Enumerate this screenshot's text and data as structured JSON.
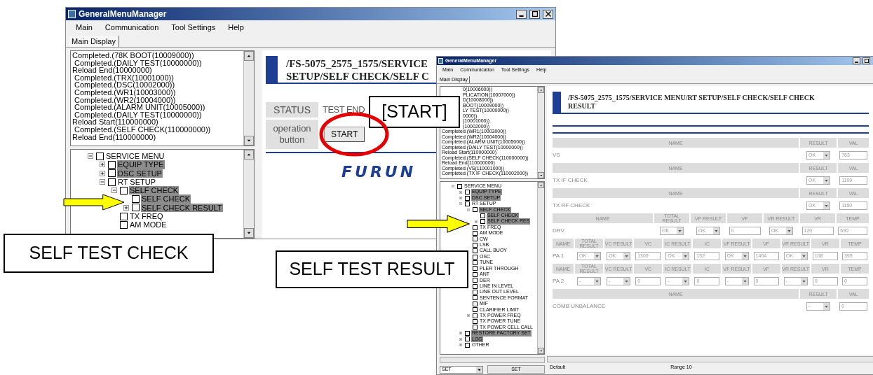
{
  "self_check_window": {
    "title": "GeneralMenuManager",
    "menu": [
      "Main",
      "Communication",
      "Tool Settings",
      "Help"
    ],
    "tab": "Main Display",
    "log": [
      "Completed.(78K BOOT(10009000))",
      " Completed.(DAILY TEST(10000000))",
      "Reload End(10000000)",
      " Completed.(TRX(10001000))",
      " Completed.(DSC(10002000))",
      " Completed.(WR1(10003000))",
      " Completed.(WR2(10004000))",
      " Completed.(ALARM UNIT(10005000))",
      " Completed.(DAILY TEST(10000000))",
      "Reload Start(110000000)",
      " Completed.(SELF CHECK(110000000))",
      "Reload End(110000000)"
    ],
    "tree": [
      {
        "label": "SERVICE MENU",
        "kind": "branch",
        "expanded": true,
        "checked": false,
        "highlighted": false,
        "children": [
          {
            "label": "EQUIP TYPE",
            "kind": "branch",
            "expanded": false,
            "checked": false,
            "highlighted": true
          },
          {
            "label": "DSC SETUP",
            "kind": "branch",
            "expanded": false,
            "checked": false,
            "highlighted": true
          },
          {
            "label": "RT SETUP",
            "kind": "branch",
            "expanded": true,
            "checked": false,
            "highlighted": false,
            "children": [
              {
                "label": "SELF CHECK",
                "kind": "branch",
                "expanded": true,
                "checked": false,
                "highlighted": true,
                "children": [
                  {
                    "label": "SELF CHECK",
                    "kind": "leaf",
                    "checked": false,
                    "highlighted": true
                  },
                  {
                    "label": "SELF CHECK RESULT",
                    "kind": "branch",
                    "expanded": false,
                    "checked": false,
                    "highlighted": true
                  }
                ]
              },
              {
                "label": "TX FREQ",
                "kind": "leaf",
                "checked": false,
                "highlighted": false
              },
              {
                "label": "AM MODE",
                "kind": "leaf",
                "checked": false,
                "highlighted": false
              }
            ]
          }
        ]
      }
    ],
    "panel": {
      "path_lines": [
        "/FS-5075_2575_1575/SERVICE",
        "SETUP/SELF CHECK/SELF C"
      ],
      "status_label": "STATUS",
      "status_value": "TEST END",
      "operation_label": "operation button",
      "button": "START",
      "logo": "FURUN"
    }
  },
  "self_check_result_window": {
    "title": "GeneralMenuManager",
    "menu": [
      "Main",
      "Communication",
      "Tool Settings",
      "Help"
    ],
    "tab": "Main Display",
    "log_partial": [
      "0(10006000))",
      "PLICATION(10007000))",
      "D(10008000))",
      "BOOT(10009000))",
      "LY TEST(10000000))",
      "0000))",
      "(10001000))",
      "(10002000))"
    ],
    "log": [
      "Completed.(WR1(10003000))",
      "Completed.(WR2(10004000))",
      "Completed.(ALARM UNIT(10005000))",
      "Completed.(DAILY TEST(10000000))",
      "Reload Start(110000000)",
      "Completed.(SELF CHECK(110000000))",
      "Reload End(110000000)",
      "Completed.(VS(110001000))",
      "Completed.(TX IF CHECK(110002000))"
    ],
    "tree": [
      {
        "label": "SERVICE MENU",
        "kind": "branch",
        "expanded": true,
        "checked": false,
        "highlighted": false,
        "children": [
          {
            "label": "EQUIP TYPE",
            "kind": "branch",
            "expanded": false,
            "checked": false,
            "highlighted": true
          },
          {
            "label": "DSC SETUP",
            "kind": "branch",
            "expanded": false,
            "checked": false,
            "highlighted": true
          },
          {
            "label": "RT SETUP",
            "kind": "branch",
            "expanded": true,
            "checked": false,
            "highlighted": false,
            "children": [
              {
                "label": "SELF CHECK",
                "kind": "branch",
                "expanded": true,
                "checked": false,
                "highlighted": true,
                "children": [
                  {
                    "label": "SELF CHECK",
                    "kind": "leaf",
                    "checked": false,
                    "highlighted": true
                  },
                  {
                    "label": "SELF CHECK RES",
                    "kind": "branch",
                    "expanded": false,
                    "checked": false,
                    "highlighted": true
                  }
                ]
              },
              {
                "label": "TX FREQ",
                "kind": "leaf",
                "checked": false,
                "highlighted": false
              },
              {
                "label": "AM MODE",
                "kind": "leaf",
                "checked": false,
                "highlighted": false
              },
              {
                "label": "CW",
                "kind": "leaf",
                "checked": false,
                "highlighted": false
              },
              {
                "label": "LSB",
                "kind": "leaf",
                "checked": false,
                "highlighted": false
              },
              {
                "label": "CALL BUOY",
                "kind": "leaf",
                "checked": false,
                "highlighted": false
              },
              {
                "label": "OSC",
                "kind": "leaf",
                "checked": false,
                "highlighted": false
              },
              {
                "label": "TUNE",
                "kind": "leaf",
                "checked": false,
                "highlighted": false
              },
              {
                "label": "PLER THROUGH",
                "kind": "leaf",
                "checked": false,
                "highlighted": false
              },
              {
                "label": "ANT",
                "kind": "leaf",
                "checked": false,
                "highlighted": false
              },
              {
                "label": "DER",
                "kind": "leaf",
                "checked": false,
                "highlighted": false
              },
              {
                "label": "LINE IN LEVEL",
                "kind": "leaf",
                "checked": false,
                "highlighted": false
              },
              {
                "label": "LINE OUT LEVEL",
                "kind": "leaf",
                "checked": false,
                "highlighted": false
              },
              {
                "label": "SENTENCE FORMAT",
                "kind": "leaf",
                "checked": false,
                "highlighted": false
              },
              {
                "label": "MIF",
                "kind": "leaf",
                "checked": false,
                "highlighted": false
              },
              {
                "label": "CLARIFIER LIMIT",
                "kind": "leaf",
                "checked": false,
                "highlighted": false
              },
              {
                "label": "TX POWER FREQ",
                "kind": "branch",
                "expanded": false,
                "checked": false,
                "highlighted": false
              },
              {
                "label": "TX POWER TUNE",
                "kind": "leaf",
                "checked": false,
                "highlighted": false
              },
              {
                "label": "TX POWER CELL CALL",
                "kind": "leaf",
                "checked": false,
                "highlighted": false
              }
            ]
          },
          {
            "label": "RESTORE FACTORY SET",
            "kind": "branch",
            "expanded": false,
            "checked": false,
            "highlighted": true
          },
          {
            "label": "LOG",
            "kind": "branch",
            "expanded": false,
            "checked": false,
            "highlighted": true
          },
          {
            "label": "OTHER",
            "kind": "branch",
            "expanded": false,
            "checked": false,
            "highlighted": false
          }
        ]
      }
    ],
    "set_select": "SET",
    "set_button": "SET",
    "panel": {
      "path": "/FS-5075_2575_1575/SERVICE MENU/RT SETUP/SELF CHECK/SELF CHECK RESULT",
      "sections": [
        {
          "columns": [
            "NAME",
            "RESULT",
            "VAL"
          ],
          "rows": [
            {
              "cells": [
                {
                  "kind": "text",
                  "value": "VS"
                },
                {
                  "kind": "select",
                  "value": "OK"
                },
                {
                  "kind": "input",
                  "value": "763"
                }
              ]
            }
          ]
        },
        {
          "columns": [
            "NAME",
            "RESULT",
            "VAL"
          ],
          "rows": [
            {
              "cells": [
                {
                  "kind": "text",
                  "value": "TX IF CHECK"
                },
                {
                  "kind": "select",
                  "value": "OK"
                },
                {
                  "kind": "input",
                  "value": "1109"
                }
              ]
            }
          ]
        },
        {
          "columns": [
            "NAME",
            "RESULT",
            "VAL"
          ],
          "rows": [
            {
              "cells": [
                {
                  "kind": "text",
                  "value": "TX RF CHECK"
                },
                {
                  "kind": "select",
                  "value": "OK"
                },
                {
                  "kind": "input",
                  "value": "1150"
                }
              ]
            }
          ]
        },
        {
          "columns": [
            "NAME",
            "TOTAL RESULT",
            "VF RESULT",
            "VF",
            "VR RESULT",
            "VR",
            "TEMP"
          ],
          "rows": [
            {
              "cells": [
                {
                  "kind": "text",
                  "value": "DRV"
                },
                {
                  "kind": "select",
                  "value": "OK"
                },
                {
                  "kind": "select",
                  "value": "OK"
                },
                {
                  "kind": "input",
                  "value": "0"
                },
                {
                  "kind": "select",
                  "value": "OK"
                },
                {
                  "kind": "input",
                  "value": "120"
                },
                {
                  "kind": "input",
                  "value": "690"
                }
              ]
            }
          ]
        },
        {
          "columns": [
            "NAME",
            "TOTAL RESULT",
            "VC RESULT",
            "VC",
            "IC RESULT",
            "IC",
            "VF RESULT",
            "VF",
            "VR RESULT",
            "VR",
            "TEMP"
          ],
          "rows": [
            {
              "cells": [
                {
                  "kind": "text",
                  "value": "PA 1"
                },
                {
                  "kind": "select",
                  "value": "OK"
                },
                {
                  "kind": "select",
                  "value": "OK"
                },
                {
                  "kind": "input",
                  "value": "1300"
                },
                {
                  "kind": "select",
                  "value": "OK"
                },
                {
                  "kind": "input",
                  "value": "152"
                },
                {
                  "kind": "select",
                  "value": "OK"
                },
                {
                  "kind": "input",
                  "value": "1404"
                },
                {
                  "kind": "select",
                  "value": "OK"
                },
                {
                  "kind": "input",
                  "value": "108"
                },
                {
                  "kind": "input",
                  "value": "395"
                }
              ]
            }
          ]
        },
        {
          "columns": [
            "NAME",
            "TOTAL RESULT",
            "VC RESULT",
            "VC",
            "IC RESULT",
            "IC",
            "VF RESULT",
            "VF",
            "VR RESULT",
            "VR",
            "TEMP"
          ],
          "rows": [
            {
              "cells": [
                {
                  "kind": "text",
                  "value": "PA 2"
                },
                {
                  "kind": "select",
                  "value": "-"
                },
                {
                  "kind": "select",
                  "value": "-"
                },
                {
                  "kind": "input",
                  "value": "0"
                },
                {
                  "kind": "select",
                  "value": "-"
                },
                {
                  "kind": "input",
                  "value": "0"
                },
                {
                  "kind": "select",
                  "value": "-"
                },
                {
                  "kind": "input",
                  "value": "0"
                },
                {
                  "kind": "select",
                  "value": "-"
                },
                {
                  "kind": "input",
                  "value": "0"
                },
                {
                  "kind": "input",
                  "value": "0"
                }
              ]
            }
          ]
        },
        {
          "columns": [
            "NAME",
            "RESULT",
            "VAL"
          ],
          "rows": [
            {
              "cells": [
                {
                  "kind": "text",
                  "value": "COMB UNBALANCE"
                },
                {
                  "kind": "select",
                  "value": "-"
                },
                {
                  "kind": "input",
                  "value": "0"
                }
              ]
            }
          ]
        }
      ]
    },
    "status_bar": [
      "Default",
      "Range 10"
    ]
  },
  "annotations": [
    {
      "kind": "callout",
      "text": "[START]"
    },
    {
      "kind": "callout",
      "text": "SELF TEST CHECK"
    },
    {
      "kind": "callout",
      "text": "SELF TEST RESULT"
    },
    {
      "kind": "arrow"
    },
    {
      "kind": "arrow"
    },
    {
      "kind": "ellipse"
    }
  ]
}
